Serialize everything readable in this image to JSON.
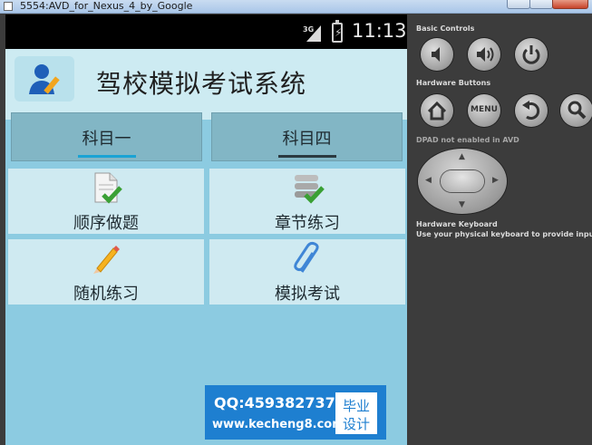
{
  "window": {
    "title": "5554:AVD_for_Nexus_4_by_Google"
  },
  "status_bar": {
    "network": "3G",
    "time": "11:13"
  },
  "app": {
    "title": "驾校模拟考试系统"
  },
  "tabs": [
    {
      "label": "科目一",
      "selected": true,
      "underline_color": "#1aa3d4"
    },
    {
      "label": "科目四",
      "selected": false,
      "underline_color": "#2b3a40"
    }
  ],
  "menu": [
    {
      "label": "顺序做题",
      "icon": "document-check-icon"
    },
    {
      "label": "章节练习",
      "icon": "stack-check-icon"
    },
    {
      "label": "随机练习",
      "icon": "pencil-icon"
    },
    {
      "label": "模拟考试",
      "icon": "paperclip-icon"
    }
  ],
  "watermark": {
    "qq": "QQ:459382737",
    "url": "www.kecheng8.com",
    "badge_line1": "毕业",
    "badge_line2": "设计"
  },
  "emulator_controls": {
    "basic_controls_heading": "Basic Controls",
    "hardware_buttons_heading": "Hardware Buttons",
    "menu_button_label": "MENU",
    "dpad_note": "DPAD not enabled in AVD",
    "keyboard_heading": "Hardware Keyboard",
    "keyboard_note": "Use your physical keyboard to provide input"
  }
}
